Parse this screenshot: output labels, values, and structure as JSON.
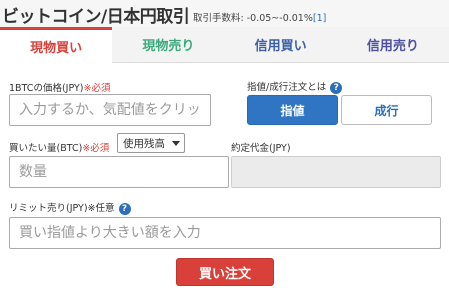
{
  "header": {
    "title": "ビットコイン/日本円取引",
    "fee_label": "取引手数料: -0.05~-0.01%",
    "fee_link": "[1]"
  },
  "tabs": [
    {
      "label": "現物買い",
      "active": true
    },
    {
      "label": "現物売り",
      "active": false
    },
    {
      "label": "信用買い",
      "active": false
    },
    {
      "label": "信用売り",
      "active": false
    }
  ],
  "price": {
    "label": "1BTCの価格(JPY)",
    "required": "※必須",
    "placeholder": "入力するか、気配値をクリッ"
  },
  "order_type": {
    "label": "指値/成行注文とは",
    "help": "?",
    "limit_label": "指値",
    "market_label": "成行"
  },
  "amount": {
    "label": "買いたい量(BTC)",
    "required": "※必須",
    "balance_option": "使用残高",
    "placeholder": "数量"
  },
  "estimate": {
    "label": "約定代金(JPY)"
  },
  "limit_sell": {
    "label": "リミット売り(JPY)",
    "optional": "※任意",
    "help": "?",
    "placeholder": "買い指値より大きい額を入力"
  },
  "submit": {
    "label": "買い注文"
  },
  "colors": {
    "buy_red": "#d9403a",
    "sell_green": "#3aaa7c",
    "primary_blue": "#2f75c4",
    "link_blue": "#2a6ebd"
  }
}
